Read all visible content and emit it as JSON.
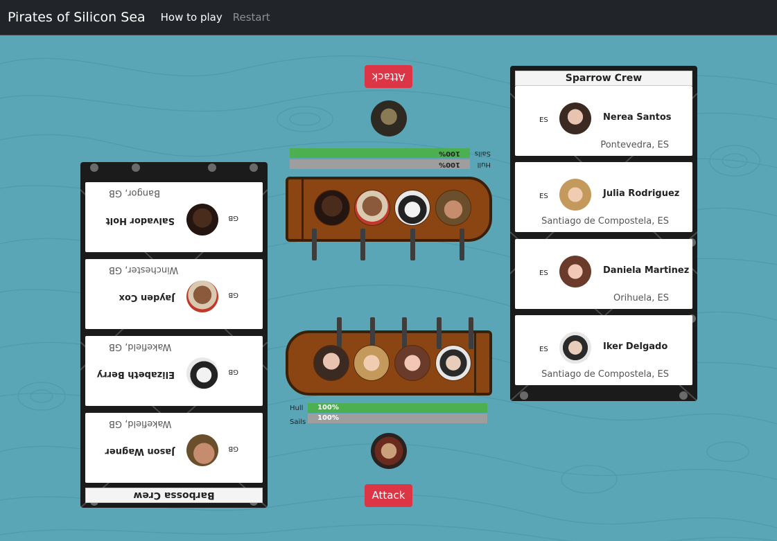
{
  "app": {
    "title": "Pirates of Silicon Sea",
    "nav": {
      "how_to_play": "How to play",
      "restart": "Restart"
    }
  },
  "colors": {
    "sea": "#5aa6b6",
    "navbar": "#212529",
    "attack": "#dc3545",
    "hull_green": "#4caf50",
    "bar_gray": "#9e9e9e",
    "ship_wood": "#8b4513"
  },
  "opponent": {
    "attack_label": "Attack",
    "captain_icon": "captain-portrait",
    "sails": {
      "label": "Sails",
      "value": "100%",
      "percent": 100
    },
    "hull": {
      "label": "Hull",
      "value": "100%",
      "percent": 100
    },
    "crew": {
      "name": "Barbossa Crew",
      "members": [
        {
          "name": "Salvador Holt",
          "location": "Bangor, GB",
          "country": "GB"
        },
        {
          "name": "Jayden Cox",
          "location": "Winchester, GB",
          "country": "GB"
        },
        {
          "name": "Elizabeth Berry",
          "location": "Wakefield, GB",
          "country": "GB"
        },
        {
          "name": "Jason Wagner",
          "location": "Wakefield, GB",
          "country": "GB"
        }
      ]
    }
  },
  "player": {
    "attack_label": "Attack",
    "captain_icon": "captain-portrait",
    "hull": {
      "label": "Hull",
      "value": "100%",
      "percent": 100
    },
    "sails": {
      "label": "Sails",
      "value": "100%",
      "percent": 100
    },
    "crew": {
      "name": "Sparrow Crew",
      "members": [
        {
          "name": "Nerea Santos",
          "location": "Pontevedra, ES",
          "country": "ES"
        },
        {
          "name": "Julia Rodriguez",
          "location": "Santiago de Compostela, ES",
          "country": "ES"
        },
        {
          "name": "Daniela Martinez",
          "location": "Orihuela, ES",
          "country": "ES"
        },
        {
          "name": "Iker Delgado",
          "location": "Santiago de Compostela, ES",
          "country": "ES"
        }
      ]
    }
  }
}
